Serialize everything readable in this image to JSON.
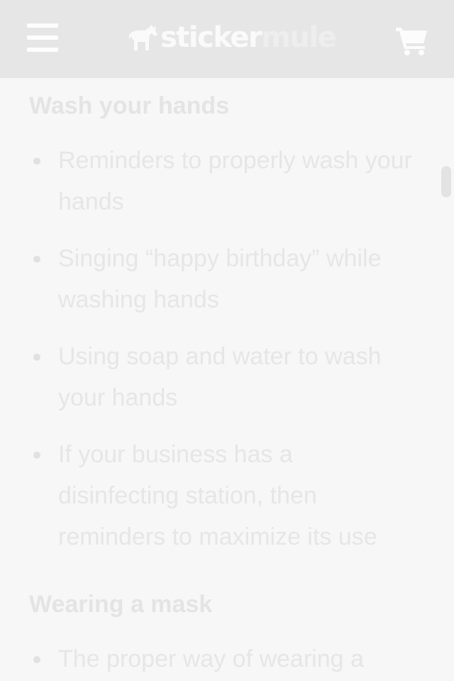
{
  "header": {
    "logo_part1": "sticker",
    "logo_part2": "mule",
    "menu_icon": "hamburger-menu-icon",
    "cart_icon": "shopping-cart-icon",
    "logo_icon": "mule-logo-icon"
  },
  "sections": [
    {
      "heading": "Wash your hands",
      "items": [
        "Reminders to properly wash your hands",
        "Singing “happy birthday” while washing hands",
        "Using soap and water to wash your hands",
        "If your business has a disinfecting station, then reminders to maximize its use"
      ]
    },
    {
      "heading": "Wearing a mask",
      "items": [
        "The proper way of wearing a"
      ]
    }
  ],
  "colors": {
    "header_bg": "#e6e6e6",
    "page_bg": "#f7f7f7",
    "text": "#e6e6e6"
  }
}
